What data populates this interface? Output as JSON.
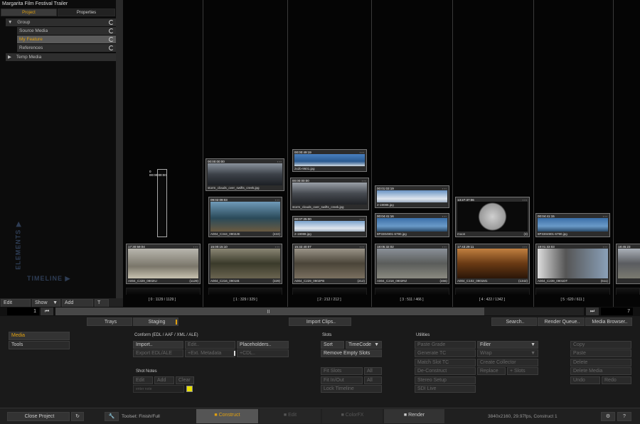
{
  "window_title": "Margarita Film Festival Trailer",
  "panel_tabs": [
    "Project",
    "Properties"
  ],
  "tree": [
    {
      "label": "Group",
      "arrow": "▼",
      "selected": false
    },
    {
      "label": "Source Media",
      "arrow": "",
      "selected": false
    },
    {
      "label": "My Feature",
      "arrow": "",
      "selected": true
    },
    {
      "label": "References",
      "arrow": "",
      "selected": false
    },
    {
      "label": "Temp Media",
      "arrow": "▶",
      "selected": false
    }
  ],
  "vertical_labels": {
    "elements": "ELEMENTS",
    "timeline": "TIMELINE"
  },
  "left_toolbar": {
    "edit": "Edit",
    "show": "Show",
    "add": "Add",
    "t": "T"
  },
  "timeline": {
    "current": "1",
    "total": "7",
    "columns": [
      {
        "label": "[ 0 : 1129 / 1129 ]",
        "clips": [
          {
            "tc": "0 00:00:00:00",
            "name": "",
            "count": "",
            "color": "#888"
          },
          {
            "tc": "17:30:59:04",
            "name": "A004_C329_0902IU",
            "count": "(1129)",
            "color": "#9a9488"
          }
        ]
      },
      {
        "label": "[ 1 : 329 / 329 ]",
        "clips": [
          {
            "tc": "00:00:00:00",
            "name": "storm_clouds_over_swifts_creek.jpg",
            "count": "",
            "color": "#555c66"
          },
          {
            "tc": "09:02:09:03",
            "name": "A004_C344_0902JE",
            "count": "(422)",
            "color": "#4a6a7a"
          },
          {
            "tc": "15:00:15:10",
            "name": "A004_C216_0901IB",
            "count": "(329)",
            "color": "#5b5a4c"
          }
        ]
      },
      {
        "label": "[ 2 : 212 / 212 ]",
        "clips": [
          {
            "tc": "00:00:49:19",
            "name": "2x2b-9601.jpg",
            "count": "",
            "color": "#3b6aa0"
          },
          {
            "tc": "00:00:00:00",
            "name": "storm_clouds_over_swifts_creek.jpg",
            "count": "",
            "color": "#666a70"
          },
          {
            "tc": "00:07:25:00",
            "name": "2-19088.jpg",
            "count": "",
            "color": "#6d8fb5"
          },
          {
            "tc": "15:32:40:07",
            "name": "A004_C229_0902PB",
            "count": "(212)",
            "color": "#6a645a"
          }
        ]
      },
      {
        "label": "[ 3 : 511 / 466 ]",
        "clips": [
          {
            "tc": "00:01:03:19",
            "name": "2-19088.jpg",
            "count": "",
            "color": "#6d8fb5"
          },
          {
            "tc": "00:04:41:16",
            "name": "8P3304901-6790.jpg",
            "count": "",
            "color": "#4a78a8"
          },
          {
            "tc": "18:05:32:02",
            "name": "A004_C218_0902RZ",
            "count": "(466)",
            "color": "#6a6c68"
          }
        ]
      },
      {
        "label": "[ 4 : 422 / 1342 ]",
        "clips": [
          {
            "tc": "13:27:37:06",
            "name": "moon",
            "count": "(3)",
            "color": "#222"
          },
          {
            "tc": "17:43:29:11",
            "name": "A004_C102_0901M1",
            "count": "(1342)",
            "color": "#8a5a2a"
          }
        ]
      },
      {
        "label": "[ 5 : 620 / 611 ]",
        "clips": [
          {
            "tc": "00:04:41:15",
            "name": "8P3304901-6790.jpg",
            "count": "",
            "color": "#4a78a8"
          },
          {
            "tc": "18:01:33:03",
            "name": "A004_C239_0901DT",
            "count": "(611)",
            "color": "#5a6878"
          }
        ]
      },
      {
        "label": "",
        "clips": [
          {
            "tc": "18:45:23",
            "name": "",
            "count": "",
            "color": "#666"
          }
        ]
      }
    ]
  },
  "nav": {
    "trays": "Trays",
    "staging": "Staging",
    "import_clips": "Import Clips..",
    "search": "Search..",
    "render_queue": "Render Queue..",
    "media_browser": "Media Browser.."
  },
  "side_menu": [
    "Media",
    "Tools"
  ],
  "conform": {
    "title": "Conform (EDL / AAF / XML / ALE)",
    "import": "Import..",
    "edit": "Edit..",
    "placeholders": "Placeholders..",
    "export_edl": "Export EDL/ALE",
    "ext_metadata": "+Ext. Metadata",
    "cdl": "+CDL.."
  },
  "shot_notes": {
    "title": "Shot Notes",
    "edit": "Edit",
    "add": "Add",
    "clear": "Clear",
    "placeholder": "enter note"
  },
  "slots": {
    "title": "Slots",
    "sort": "Sort",
    "timecode": "TimeCode",
    "remove_empty": "Remove Empty Slots",
    "fit_slots": "Fit Slots",
    "fit_in_out": "Fit In/Out",
    "lock_timeline": "Lock Timeline",
    "all": "All",
    "all2": "All"
  },
  "utilities": {
    "title": "Utilities",
    "col1": [
      "Paste Grade",
      "Generate TC",
      "Match Slot TC",
      "De-Construct",
      "Stereo Setup",
      "SDI Live"
    ],
    "filler": "Filler",
    "wrap": "Wrap",
    "create_collector": "Create Collector",
    "replace": "Replace",
    "plus_slots": "+ Slots",
    "col3": [
      "Copy",
      "Paste",
      "Delete",
      "Delete Media",
      "Undo",
      "Redo"
    ]
  },
  "statusbar": {
    "close_project": "Close Project",
    "toolset": "Toolset: Finish/Full",
    "tabs": [
      "Construct",
      "Edit",
      "ColorFX",
      "Render"
    ],
    "info": "3840x2160, 29.97fps, Construct 1",
    "help": "?"
  },
  "colors": {
    "accent": "#e0a010",
    "selected_row": "#5a5a5a",
    "active_tab": "#555555"
  }
}
